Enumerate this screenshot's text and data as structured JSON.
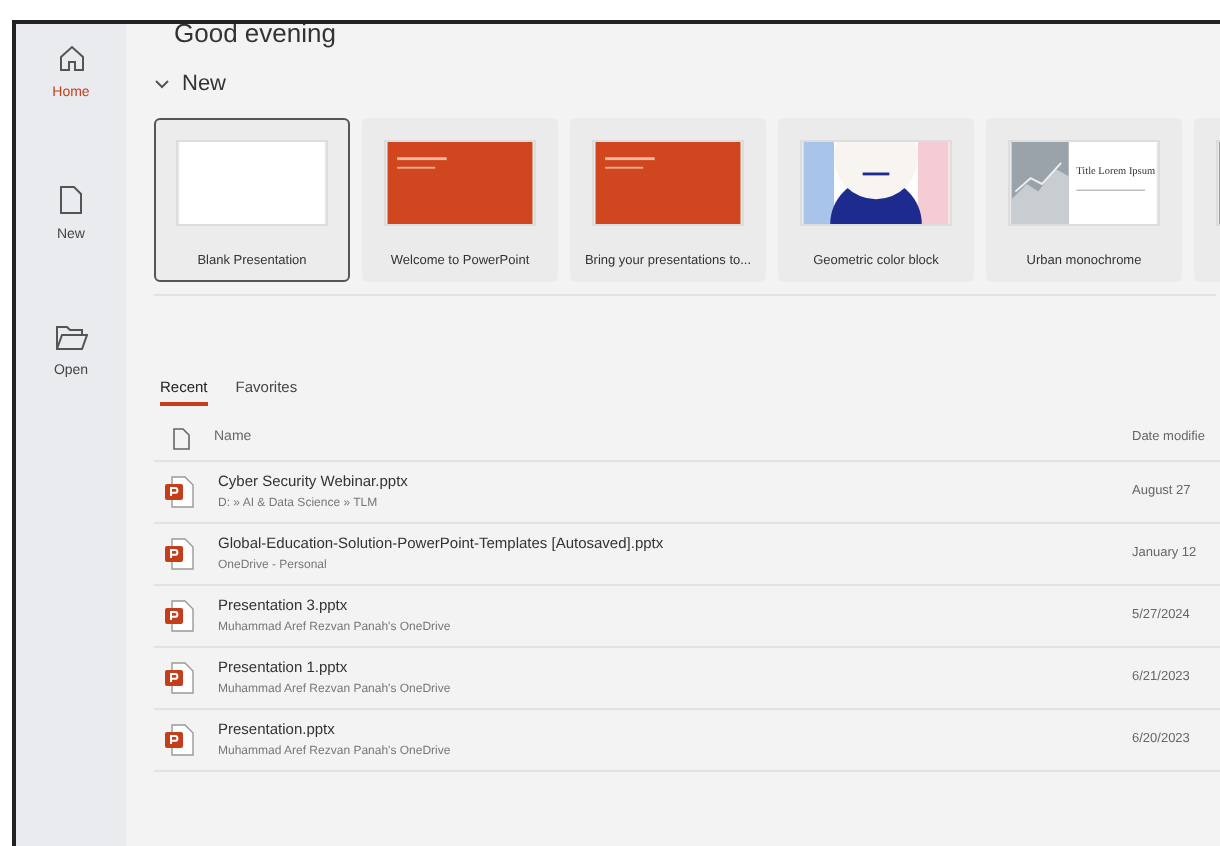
{
  "sidebar": {
    "items": [
      {
        "kind": "home",
        "label": "Home",
        "selected": true
      },
      {
        "kind": "new",
        "label": "New",
        "selected": false
      },
      {
        "kind": "open",
        "label": "Open",
        "selected": false
      }
    ]
  },
  "greeting": "Good evening",
  "new_section": {
    "title": "New",
    "expanded": true,
    "templates": [
      {
        "kind": "blank",
        "label": "Blank Presentation",
        "selected": true
      },
      {
        "kind": "red",
        "label": "Welcome to PowerPoint",
        "selected": false
      },
      {
        "kind": "red",
        "label": "Bring your presentations to...",
        "selected": false
      },
      {
        "kind": "geometric",
        "label": "Geometric color block",
        "selected": false
      },
      {
        "kind": "urban",
        "thumb_title": "Title Lorem Ipsum",
        "label": "Urban monochrome",
        "selected": false
      },
      {
        "kind": "dark",
        "selected": false
      }
    ]
  },
  "tabs": [
    {
      "label": "Recent",
      "selected": true
    },
    {
      "label": "Favorites",
      "selected": false
    }
  ],
  "table": {
    "columns": [
      "Name",
      "Date modifie"
    ],
    "rows": [
      {
        "name": "Cyber Security Webinar.pptx",
        "location": "D: » AI & Data Science » TLM",
        "date": "August 27"
      },
      {
        "name": "Global-Education-Solution-PowerPoint-Templates [Autosaved].pptx",
        "location": "OneDrive - Personal",
        "date": "January 12"
      },
      {
        "name": "Presentation 3.pptx",
        "location": "Muhammad Aref Rezvan Panah's OneDrive",
        "date": "5/27/2024"
      },
      {
        "name": "Presentation 1.pptx",
        "location": "Muhammad Aref Rezvan Panah's OneDrive",
        "date": "6/21/2023"
      },
      {
        "name": "Presentation.pptx",
        "location": "Muhammad Aref Rezvan Panah's OneDrive",
        "date": "6/20/2023"
      }
    ]
  }
}
